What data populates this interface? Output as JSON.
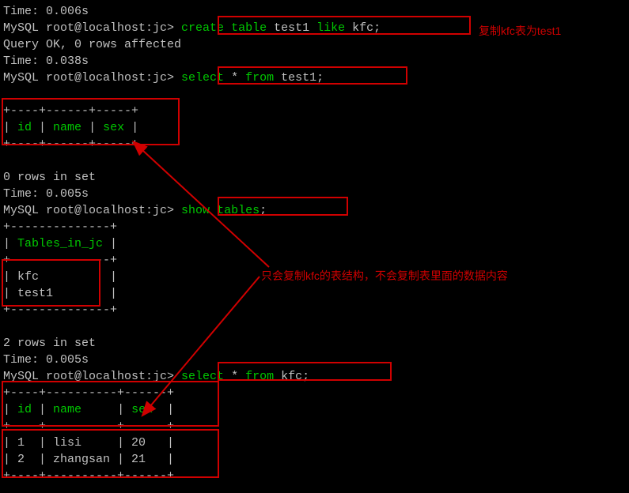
{
  "lines": {
    "l1": "Time: 0.006s",
    "prompt": "MySQL root@localhost:jc> ",
    "cmd1_a": "create",
    "cmd1_b": " table",
    "cmd1_c": " test1 ",
    "cmd1_d": "like",
    "cmd1_e": " kfc;",
    "l3": "Query OK, 0 rows affected",
    "l4": "Time: 0.038s",
    "cmd2_a": "select",
    "cmd2_b": " * ",
    "cmd2_c": "from",
    "cmd2_d": " test1;",
    "sep1": "+----+------+-----+",
    "hdr1": "| ",
    "hdr1_id": "id",
    "hdr1_s1": " | ",
    "hdr1_name": "name",
    "hdr1_s2": " | ",
    "hdr1_sex": "sex",
    "hdr1_s3": " |",
    "l_empty_rows": "0 rows in set",
    "l_time005": "Time: 0.005s",
    "cmd3_a": "show",
    "cmd3_b": " tables",
    "cmd3_c": ";",
    "sep2": "+--------------+",
    "hdr2_a": "| ",
    "hdr2_b": "Tables_in_jc",
    "hdr2_c": " |",
    "row_kfc": "| kfc          |",
    "row_test1": "| test1        |",
    "l_2rows": "2 rows in set",
    "cmd4_a": "select",
    "cmd4_b": " * ",
    "cmd4_c": "from",
    "cmd4_d": " kfc;",
    "sep3": "+----+----------+------+",
    "hdr3_a": "| ",
    "hdr3_id": "id",
    "hdr3_s1": " | ",
    "hdr3_name": "name",
    "hdr3_s2": "     | ",
    "hdr3_sex": "sex",
    "hdr3_s3": "  |",
    "row3_1": "| 1  | lisi     | 20   |",
    "row3_2": "| 2  | zhangsan | 21   |"
  },
  "annotations": {
    "a1": "复制kfc表为test1",
    "a2": "只会复制kfc的表结构，不会复制表里面的数据内容"
  }
}
